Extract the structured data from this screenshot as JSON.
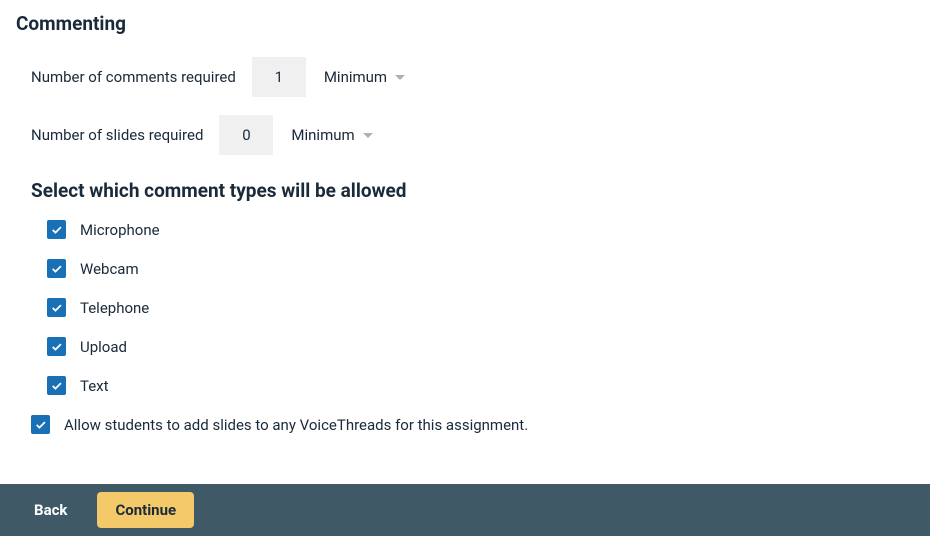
{
  "heading": "Commenting",
  "numComments": {
    "label": "Number of comments required",
    "value": "1",
    "mode": "Minimum"
  },
  "numSlides": {
    "label": "Number of slides required",
    "value": "0",
    "mode": "Minimum"
  },
  "commentTypesHeading": "Select which comment types will be allowed",
  "commentTypes": {
    "microphone": {
      "label": "Microphone",
      "checked": true
    },
    "webcam": {
      "label": "Webcam",
      "checked": true
    },
    "telephone": {
      "label": "Telephone",
      "checked": true
    },
    "upload": {
      "label": "Upload",
      "checked": true
    },
    "text": {
      "label": "Text",
      "checked": true
    }
  },
  "allowAddSlides": {
    "label": "Allow students to add slides to any VoiceThreads for this assignment.",
    "checked": true
  },
  "footer": {
    "back": "Back",
    "continue": "Continue"
  }
}
